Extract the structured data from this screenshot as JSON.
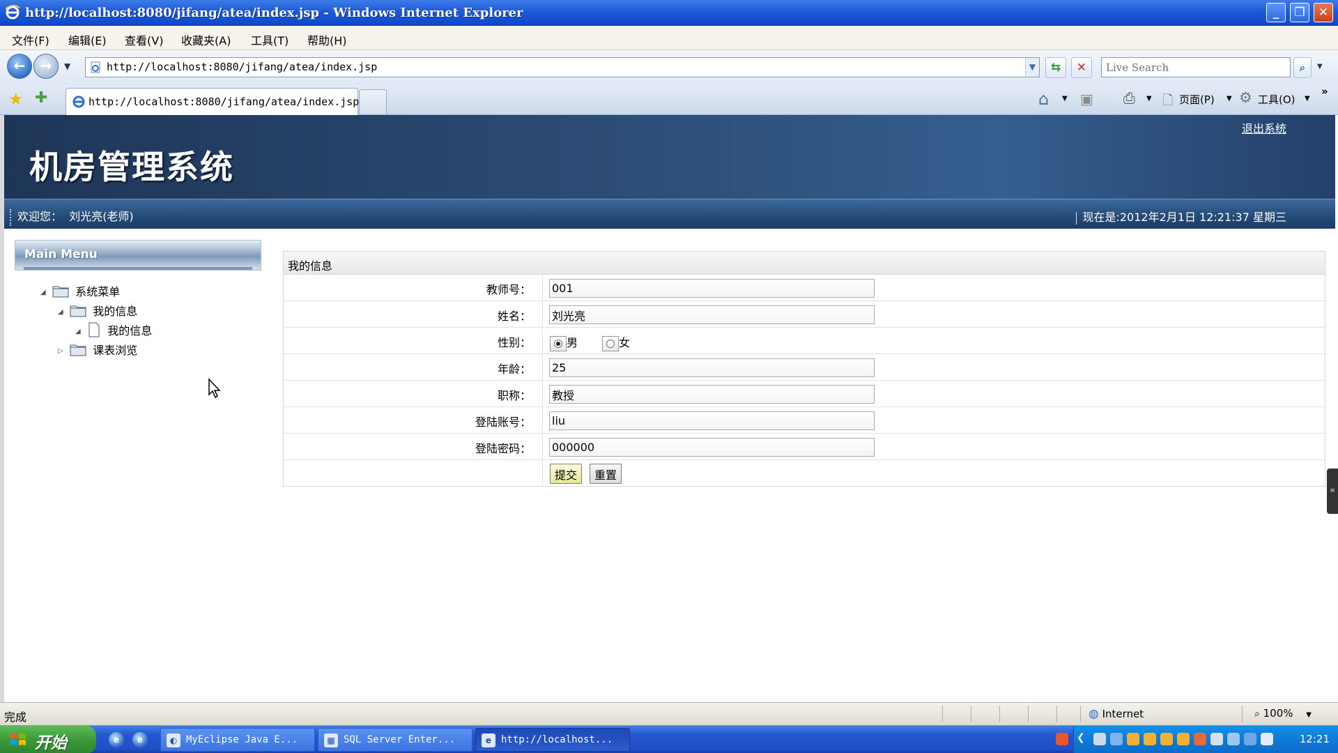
{
  "window": {
    "title": "http://localhost:8080/jifang/atea/index.jsp - Windows Internet Explorer",
    "min_label": "_",
    "max_label": "❐",
    "close_label": "✕"
  },
  "menu": [
    {
      "label": "文件(F)"
    },
    {
      "label": "编辑(E)"
    },
    {
      "label": "查看(V)"
    },
    {
      "label": "收藏夹(A)"
    },
    {
      "label": "工具(T)"
    },
    {
      "label": "帮助(H)"
    }
  ],
  "address": {
    "url": "http://localhost:8080/jifang/atea/index.jsp",
    "search_placeholder": "Live Search"
  },
  "tabs": {
    "active_title": "http://localhost:8080/jifang/atea/index.jsp"
  },
  "command_bar": {
    "page_label": "页面(P)",
    "tools_label": "工具(O)"
  },
  "site": {
    "logout": "退出系统",
    "title": "机房管理系统",
    "welcome_label": "欢迎您：",
    "user_name": "刘光亮(老师)",
    "datetime": "现在是:2012年2月1日  12:21:37 星期三"
  },
  "sidebar": {
    "header": "Main Menu",
    "tree": [
      {
        "label": "系统菜单",
        "toggle": "◢",
        "level": 0
      },
      {
        "label": "我的信息",
        "toggle": "◢",
        "level": 1
      },
      {
        "label": "我的信息",
        "toggle": "◢",
        "level": 2
      },
      {
        "label": "课表浏览",
        "toggle": "▷",
        "level": 1
      }
    ]
  },
  "form": {
    "header": "我的信息",
    "fields": {
      "teacher_id": {
        "label": "教师号：",
        "value": "001"
      },
      "name": {
        "label": "姓名：",
        "value": "刘光亮"
      },
      "gender": {
        "label": "性别：",
        "options": [
          "男",
          "女"
        ],
        "selected": "男"
      },
      "age": {
        "label": "年龄：",
        "value": "25"
      },
      "title": {
        "label": "职称：",
        "value": "教授"
      },
      "account": {
        "label": "登陆账号：",
        "value": "liu"
      },
      "password": {
        "label": "登陆密码：",
        "value": "000000"
      }
    },
    "submit_label": "提交",
    "reset_label": "重置"
  },
  "status": {
    "text": "完成",
    "zone": "Internet",
    "zoom": "100%"
  },
  "taskbar": {
    "start_label": "开始",
    "tasks": [
      {
        "label": "MyEclipse Java E..."
      },
      {
        "label": "SQL Server Enter..."
      },
      {
        "label": "http://localhost..."
      }
    ],
    "clock": "12:21"
  }
}
